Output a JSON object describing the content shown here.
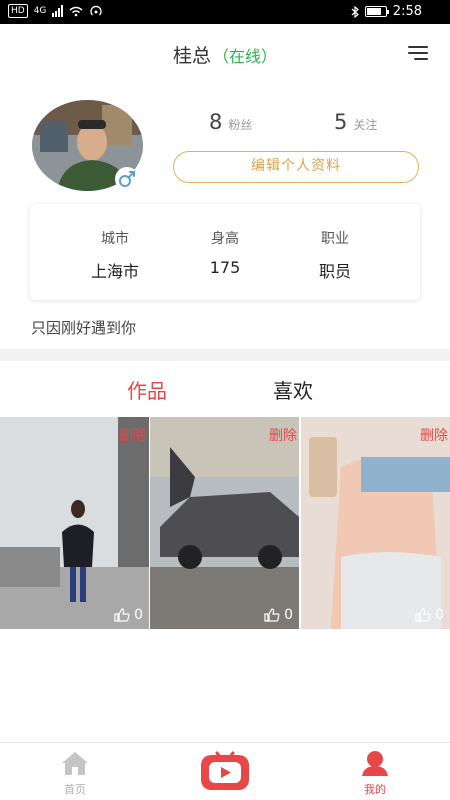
{
  "status_bar": {
    "left_tags": [
      "HD",
      "4G"
    ],
    "time": "2:58",
    "battery_level": 0.8
  },
  "header": {
    "name": "桂总",
    "online_status": "（在线）",
    "menu_icon": "hamburger-menu-icon"
  },
  "profile": {
    "followers_count": "8",
    "followers_label": "粉丝",
    "following_count": "5",
    "following_label": "关注",
    "edit_button_label": "编辑个人资料",
    "gender_icon": "male-icon",
    "accent_color": "#d8a44a"
  },
  "info": {
    "city_label": "城市",
    "city_value": "上海市",
    "height_label": "身高",
    "height_value": "175",
    "job_label": "职业",
    "job_value": "职员"
  },
  "bio": "只因刚好遇到你",
  "tabs": {
    "works": "作品",
    "likes": "喜欢",
    "active_color": "#e8474a"
  },
  "posts": [
    {
      "delete_label": "删除",
      "likes": "0"
    },
    {
      "delete_label": "删除",
      "likes": "0"
    },
    {
      "delete_label": "删除",
      "likes": "0"
    }
  ],
  "bottom_nav": {
    "home_label": "首页",
    "center_icon": "video-tv-icon",
    "mine_label": "我的"
  }
}
